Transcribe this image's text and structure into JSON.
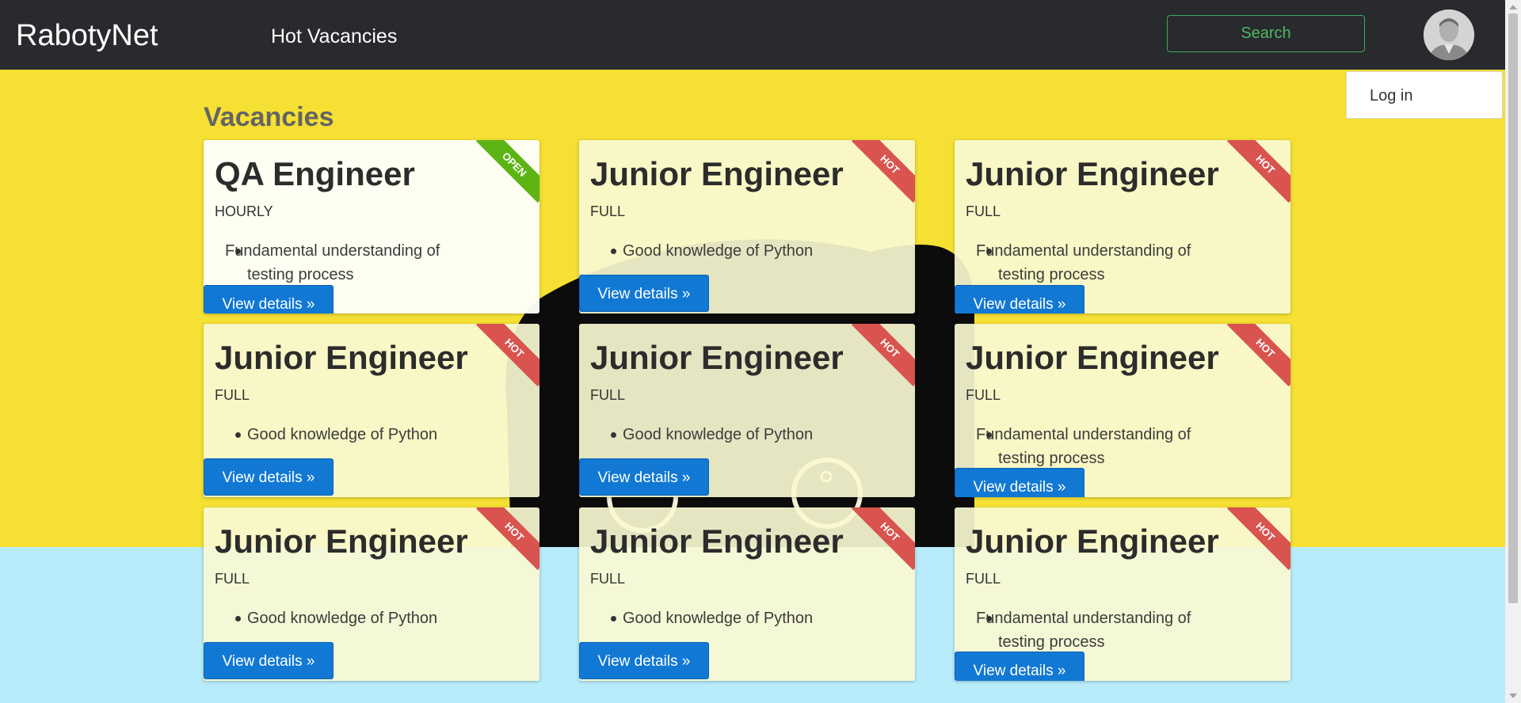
{
  "header": {
    "brand": "RabotyNet",
    "nav_link": "Hot Vacancies",
    "search_label": "Search",
    "avatar_icon": "user-avatar-icon"
  },
  "user_menu": {
    "items": [
      {
        "label": "Log in"
      }
    ]
  },
  "main": {
    "section_title": "Vacancies",
    "colors": {
      "hero_background": "#f5e033",
      "lower_background": "#b8ecfa",
      "card_background": "#f8f8d2",
      "hot_ribbon": "#d9534f",
      "open_ribbon": "#5cb414",
      "button": "#1178d4"
    },
    "vacancies": [
      {
        "title": "QA Engineer",
        "type": "HOURLY",
        "badge": "OPEN",
        "requirements": [
          "Fundamental understanding of testing process"
        ],
        "button": "View details »"
      },
      {
        "title": "Junior Engineer",
        "type": "FULL",
        "badge": "HOT",
        "requirements": [
          "Good knowledge of Python"
        ],
        "button": "View details »"
      },
      {
        "title": "Junior Engineer",
        "type": "FULL",
        "badge": "HOT",
        "requirements": [
          "Fundamental understanding of testing process"
        ],
        "button": "View details »"
      },
      {
        "title": "Junior Engineer",
        "type": "FULL",
        "badge": "HOT",
        "requirements": [
          "Good knowledge of Python"
        ],
        "button": "View details »"
      },
      {
        "title": "Junior Engineer",
        "type": "FULL",
        "badge": "HOT",
        "requirements": [
          "Good knowledge of Python"
        ],
        "button": "View details »"
      },
      {
        "title": "Junior Engineer",
        "type": "FULL",
        "badge": "HOT",
        "requirements": [
          "Fundamental understanding of testing process"
        ],
        "button": "View details »"
      },
      {
        "title": "Junior Engineer",
        "type": "FULL",
        "badge": "HOT",
        "requirements": [
          "Good knowledge of Python"
        ],
        "button": "View details »"
      },
      {
        "title": "Junior Engineer",
        "type": "FULL",
        "badge": "HOT",
        "requirements": [
          "Good knowledge of Python"
        ],
        "button": "View details »"
      },
      {
        "title": "Junior Engineer",
        "type": "FULL",
        "badge": "HOT",
        "requirements": [
          "Fundamental understanding of testing process"
        ],
        "button": "View details »"
      }
    ]
  }
}
